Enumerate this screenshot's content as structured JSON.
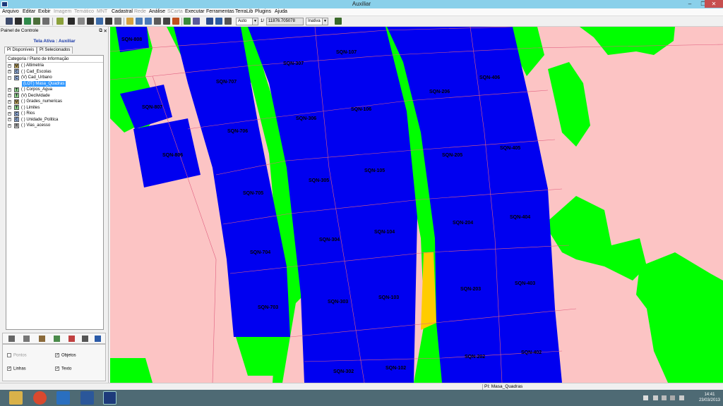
{
  "window": {
    "title": "Auxiliar",
    "controls": {
      "minimize": "–",
      "maximize": "❐",
      "close": "✕"
    }
  },
  "menu": [
    "Arquivo",
    "Editar",
    "Exibir",
    "Imagem",
    "Temático",
    "MNT",
    "Cadastral",
    "Rede",
    "Análise",
    "SCarta",
    "Executar",
    "Ferramentas",
    "TerraLib",
    "Plugins",
    "Ajuda"
  ],
  "menu_disabled": [
    "Imagem",
    "Temático",
    "MNT",
    "Rede",
    "SCarta"
  ],
  "toolbar": {
    "scale_mode": "Auto",
    "scale_prefix": "1/",
    "scale_value": "11876.705078",
    "state": "Inativa"
  },
  "panel": {
    "title": "Painel de Controle",
    "float": "⧉",
    "close": "✕",
    "active_screen": "Tela Ativa : Auxiliar",
    "tabs": [
      "PI Disponíveis",
      "PI Selecionados"
    ],
    "tree_header": "Categoria / Plano de Informação",
    "categories": [
      {
        "type": "M",
        "label": "( ) Altimetria",
        "expander": "+"
      },
      {
        "type": "C",
        "label": "( ) Cad_Escolas",
        "expander": "+"
      },
      {
        "type": "C",
        "label": "(V) Cad_Urbano",
        "expander": "−"
      },
      {
        "type": "T",
        "label": "( ) Corpos_Agua",
        "expander": "+"
      },
      {
        "type": "T",
        "label": "(V) Declividade",
        "expander": "+"
      },
      {
        "type": "M",
        "label": "( ) Grades_numericas",
        "expander": "+"
      },
      {
        "type": "T",
        "label": "( ) Limites",
        "expander": "+"
      },
      {
        "type": "C",
        "label": "( ) Rios",
        "expander": "+"
      },
      {
        "type": "C",
        "label": "( ) Unidade_Politica",
        "expander": "+"
      },
      {
        "type": "R",
        "label": "( ) Vias_acesso",
        "expander": "+"
      }
    ],
    "selected_child": "(LOT) Masa_Quadras",
    "options": {
      "pontos": {
        "label": "Pontos",
        "checked": false,
        "enabled": false
      },
      "objetos": {
        "label": "Objetos",
        "checked": true,
        "enabled": true
      },
      "linhas": {
        "label": "Linhas",
        "checked": true,
        "enabled": true
      },
      "texto": {
        "label": "Texto",
        "checked": true,
        "enabled": true
      }
    }
  },
  "map": {
    "colors": {
      "background": "#fcc4c4",
      "blocks": "#0000f0",
      "vegetation": "#00ff00",
      "highlight": "#ffcc00",
      "lines": "#e06080"
    },
    "labels": [
      "SQN-808",
      "SQN-807",
      "SQN-806",
      "SQN-707",
      "SQN-706",
      "SQN-705",
      "SQN-704",
      "SQN-703",
      "SQN-307",
      "SQN-306",
      "SQN-305",
      "SQN-304",
      "SQN-303",
      "SQN-302",
      "SQN-107",
      "SQN-106",
      "SQN-105",
      "SQN-104",
      "SQN-103",
      "SQN-102",
      "SQN-206",
      "SQN-205",
      "SQN-204",
      "SQN-203",
      "SQN-202",
      "SQN-406",
      "SQN-405",
      "SQN-404",
      "SQN-403",
      "SQN-402"
    ]
  },
  "status": {
    "text": "PI: Masa_Quadras"
  },
  "taskbar": {
    "apps": [
      "file-explorer",
      "chrome",
      "lync",
      "word",
      "terraview"
    ],
    "time": "14:41",
    "date": "23/03/2013"
  }
}
